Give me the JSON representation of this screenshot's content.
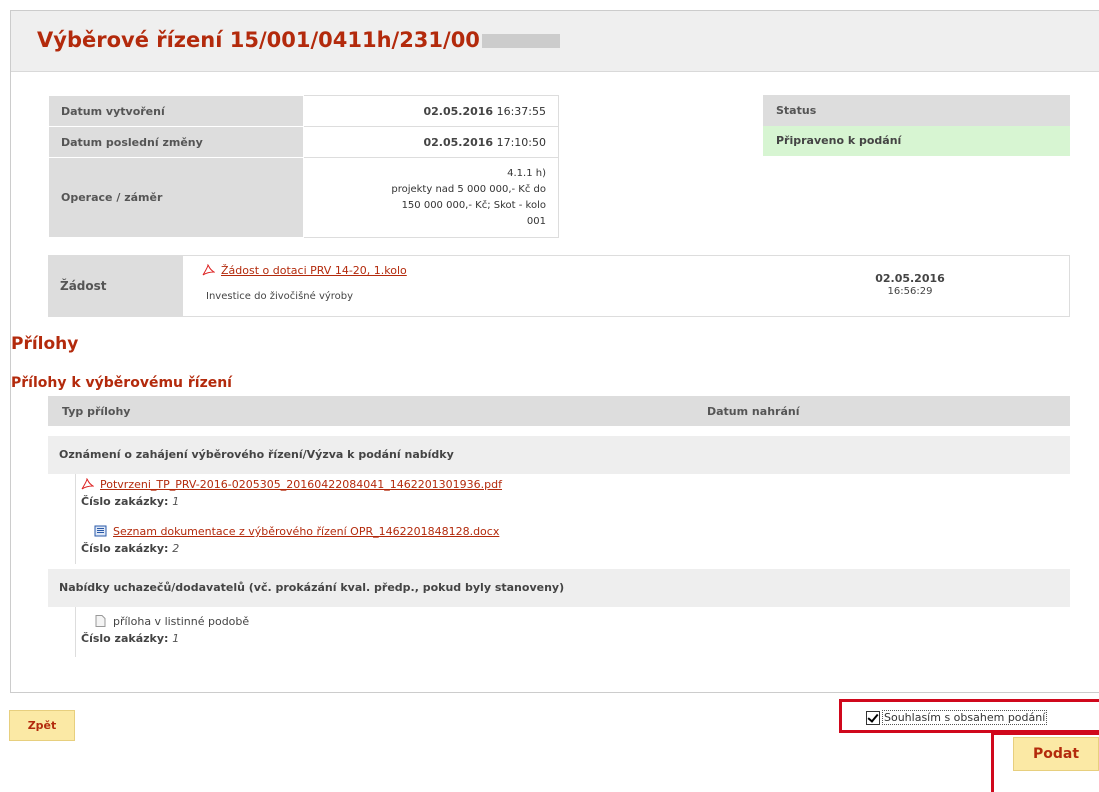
{
  "header": {
    "title": "Výběrové řízení 15/001/0411h/231/00"
  },
  "info": {
    "created_label": "Datum vytvoření",
    "created_date": "02.05.2016",
    "created_time": "16:37:55",
    "modified_label": "Datum poslední změny",
    "modified_date": "02.05.2016",
    "modified_time": "17:10:50",
    "operation_label": "Operace / záměr",
    "operation_lines": [
      "4.1.1 h)",
      "projekty nad 5 000 000,- Kč do",
      "150 000 000,- Kč; Skot - kolo",
      "001"
    ]
  },
  "status": {
    "label": "Status",
    "value": "Připraveno k podání",
    "color": "#d7f5d2"
  },
  "zadost": {
    "label": "Žádost",
    "link": "Žádost o dotaci PRV 14-20, 1.kolo",
    "description": "Investice do živočišné výroby",
    "date": "02.05.2016",
    "time": "16:56:29"
  },
  "attachments": {
    "heading": "Přílohy",
    "subheading": "Přílohy k výběrovému řízení",
    "col_type": "Typ přílohy",
    "col_date": "Datum nahrání",
    "groups": [
      {
        "title": "Oznámení o zahájení výběrového řízení/Výzva k podání nabídky",
        "items": [
          {
            "icon": "pdf-icon",
            "name": "Potvrzeni_TP_PRV-2016-0205305_20160422084041_1462201301936.pdf",
            "meta_label": "Číslo zakázky:",
            "meta_value": "1"
          },
          {
            "icon": "word-icon",
            "name": "Seznam dokumentace z výběrového řízení OPR_1462201848128.docx",
            "meta_label": "Číslo zakázky:",
            "meta_value": "2"
          }
        ]
      },
      {
        "title": "Nabídky uchazečů/dodavatelů (vč. prokázání kval. předp., pokud byly stanoveny)",
        "items": [
          {
            "icon": "document-icon",
            "name": "příloha v listinné podobě",
            "meta_label": "Číslo zakázky:",
            "meta_value": "1"
          }
        ]
      }
    ]
  },
  "footer": {
    "back_label": "Zpět",
    "consent_label": "Souhlasím s obsahem podání",
    "consent_checked": true,
    "submit_label": "Podat",
    "highlight_color": "#d0081c"
  },
  "colors": {
    "accent": "#b32a0c",
    "button_bg": "#fbe9a5"
  }
}
